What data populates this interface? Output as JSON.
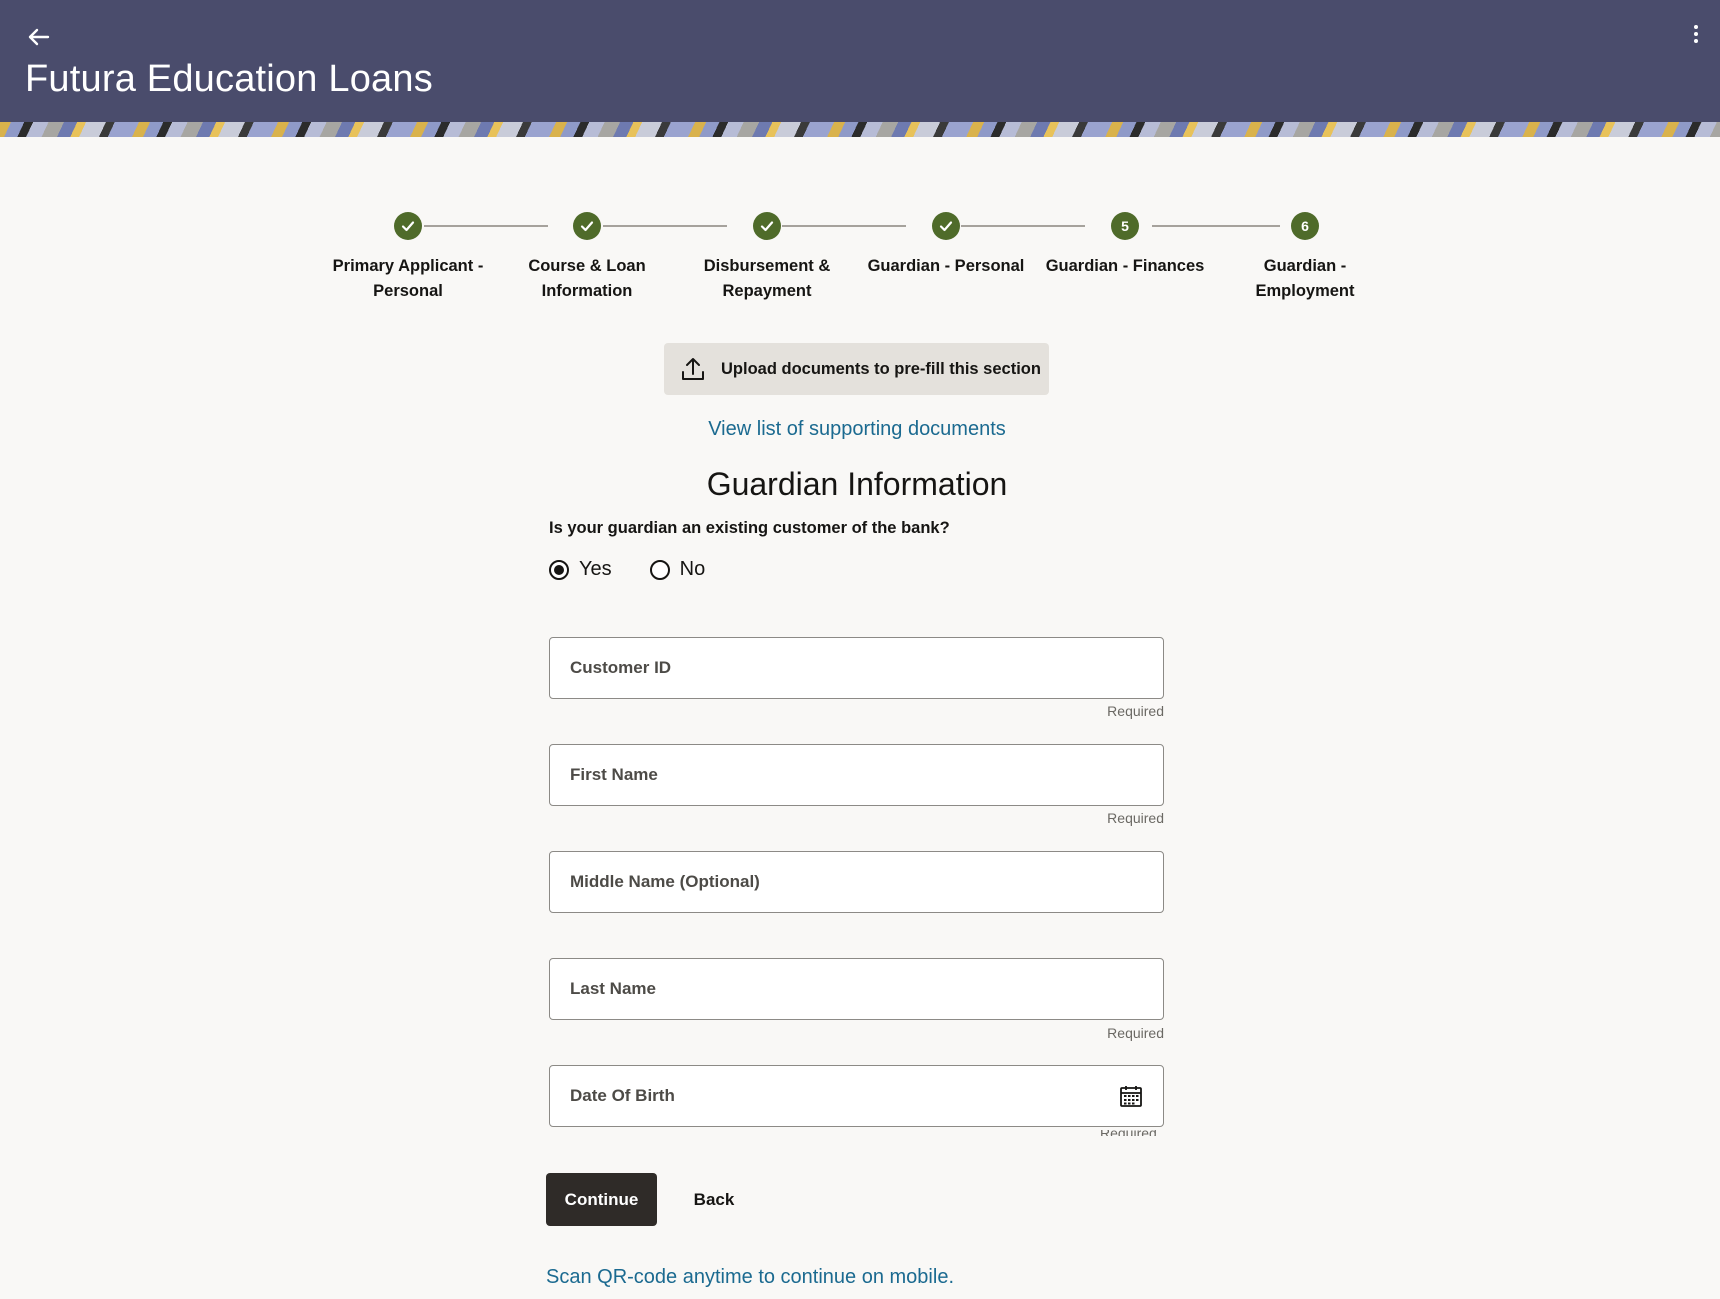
{
  "header": {
    "back_icon": "arrow-left-icon",
    "title": "Futura Education Loans",
    "menu_icon": "kebab-menu-icon"
  },
  "stepper": {
    "steps": [
      {
        "label_line1": "Primary Applicant -",
        "label_line2": "Personal",
        "state": "completed",
        "marker": ""
      },
      {
        "label_line1": "Course & Loan",
        "label_line2": "Information",
        "state": "completed",
        "marker": ""
      },
      {
        "label_line1": "Disbursement &",
        "label_line2": "Repayment",
        "state": "completed",
        "marker": ""
      },
      {
        "label_line1": "Guardian - Personal",
        "label_line2": "",
        "state": "completed",
        "marker": ""
      },
      {
        "label_line1": "Guardian - Finances",
        "label_line2": "",
        "state": "current",
        "marker": "5"
      },
      {
        "label_line1": "Guardian -",
        "label_line2": "Employment",
        "state": "upcoming",
        "marker": "6"
      }
    ],
    "accent_color": "#4f6b2a"
  },
  "upload": {
    "icon": "upload-icon",
    "label": "Upload documents to pre-fill this section"
  },
  "supporting_docs_link": "View list of supporting documents",
  "section_title": "Guardian Information",
  "existing_customer": {
    "question": "Is your guardian an existing customer of the bank?",
    "options": [
      {
        "label": "Yes",
        "selected": true
      },
      {
        "label": "No",
        "selected": false
      }
    ]
  },
  "fields": {
    "customer_id": {
      "placeholder": "Customer ID",
      "value": "",
      "helper": "Required"
    },
    "first_name": {
      "placeholder": "First Name",
      "value": "",
      "helper": "Required"
    },
    "middle_name": {
      "placeholder": "Middle Name (Optional)",
      "value": ""
    },
    "last_name": {
      "placeholder": "Last Name",
      "value": "",
      "helper": "Required"
    },
    "date_of_birth": {
      "placeholder": "Date Of Birth",
      "value": "",
      "icon": "calendar-icon",
      "helper": "Required"
    }
  },
  "actions": {
    "continue_label": "Continue",
    "back_label": "Back"
  },
  "qr_link": "Scan QR-code anytime to continue on mobile.",
  "colors": {
    "header_bg": "#4a4c6c",
    "link": "#1b6a90",
    "primary_button": "#2f2b28"
  }
}
